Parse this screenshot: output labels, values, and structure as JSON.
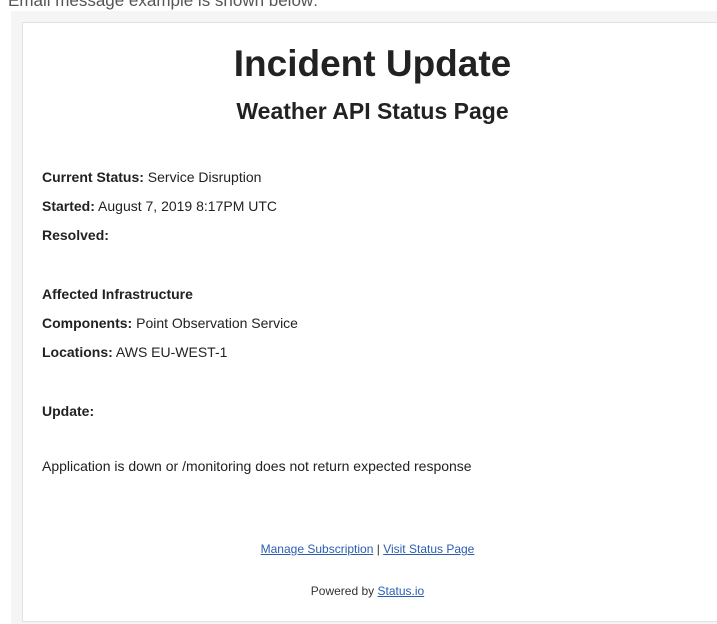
{
  "intro_text": "Email message example is shown below:",
  "email": {
    "title": "Incident Update",
    "subtitle": "Weather API Status Page",
    "current_status_label": "Current Status:",
    "current_status_value": "Service Disruption",
    "started_label": "Started:",
    "started_value": "August 7, 2019 8:17PM UTC",
    "resolved_label": "Resolved:",
    "affected_heading": "Affected Infrastructure",
    "components_label": "Components:",
    "components_value": "Point Observation Service",
    "locations_label": "Locations:",
    "locations_value": "AWS EU-WEST-1",
    "update_label": "Update:",
    "update_message": "Application is down or /monitoring does not return expected response",
    "footer": {
      "manage_subscription": "Manage Subscription",
      "separator": "|",
      "visit_status_page": "Visit Status Page",
      "powered_by_prefix": "Powered by",
      "powered_by_link": "Status.io"
    }
  },
  "colors": {
    "link": "#2a5db0",
    "text": "#222222",
    "frame": "#f5f5f5"
  }
}
